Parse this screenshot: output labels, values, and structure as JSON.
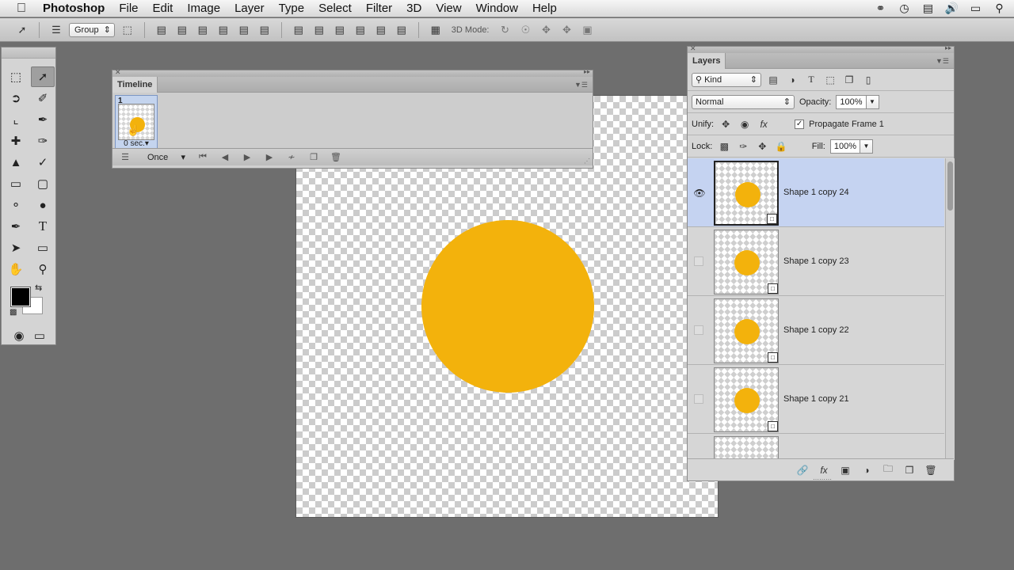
{
  "menubar": {
    "app_name": "Photoshop",
    "items": [
      "File",
      "Edit",
      "Image",
      "Layer",
      "Type",
      "Select",
      "Filter",
      "3D",
      "View",
      "Window",
      "Help"
    ],
    "status_icons": [
      "creative-cloud-icon",
      "time-machine-icon",
      "display-icon",
      "volume-icon",
      "screen-icon",
      "spotlight-icon"
    ]
  },
  "options_bar": {
    "auto_select_value": "Group",
    "mode_label": "3D Mode:"
  },
  "timeline": {
    "title": "Timeline",
    "frame_number": "1",
    "frame_delay": "0 sec.",
    "loop_value": "Once"
  },
  "layers_panel": {
    "title": "Layers",
    "filter_kind": "Kind",
    "blend_mode": "Normal",
    "opacity_label": "Opacity:",
    "opacity_value": "100%",
    "unify_label": "Unify:",
    "propagate_label": "Propagate Frame 1",
    "lock_label": "Lock:",
    "fill_label": "Fill:",
    "fill_value": "100%",
    "layers": [
      {
        "name": "Shape 1 copy 24",
        "visible": true,
        "selected": true
      },
      {
        "name": "Shape 1 copy 23",
        "visible": false,
        "selected": false
      },
      {
        "name": "Shape 1 copy 22",
        "visible": false,
        "selected": false
      },
      {
        "name": "Shape 1 copy 21",
        "visible": false,
        "selected": false
      },
      {
        "name": "",
        "visible": false,
        "selected": false
      }
    ]
  },
  "colors": {
    "circle": "#f3b20c",
    "foreground": "#000000",
    "background": "#ffffff",
    "selection": "#c5d3f1"
  }
}
